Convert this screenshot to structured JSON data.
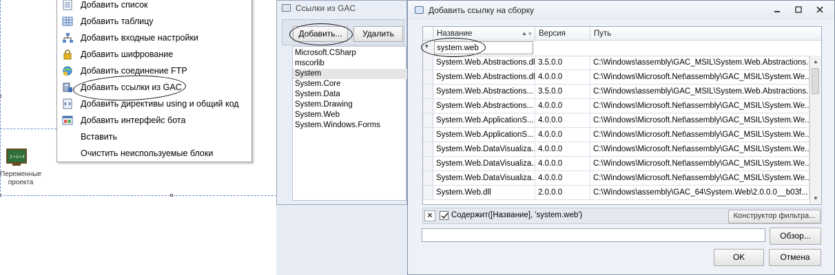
{
  "context_menu": {
    "items": [
      {
        "label": "Добавить список",
        "icon": "list-icon"
      },
      {
        "label": "Добавить таблицу",
        "icon": "table-icon"
      },
      {
        "label": "Добавить входные настройки",
        "icon": "input-settings-icon"
      },
      {
        "label": "Добавить шифрование",
        "icon": "lock-icon"
      },
      {
        "label": "Добавить соединение FTP",
        "icon": "ftp-icon"
      },
      {
        "label": "Добавить ссылки из GAC",
        "icon": "gac-references-icon"
      },
      {
        "label": "Добавить директивы using и общий код",
        "icon": "code-icon"
      },
      {
        "label": "Добавить интерфейс бота",
        "icon": "bot-interface-icon"
      },
      {
        "label": "Вставить",
        "icon": ""
      },
      {
        "label": "Очистить неиспользуемые блоки",
        "icon": ""
      }
    ]
  },
  "canvas": {
    "toolbox_label": "Переменные проекта"
  },
  "gac_window": {
    "title": "Ссылки из GAC",
    "add_button": "Добавить...",
    "remove_button": "Удалить",
    "items": [
      "Microsoft.CSharp",
      "mscorlib",
      "System",
      "System.Core",
      "System.Data",
      "System.Drawing",
      "System.Web",
      "System.Windows.Forms"
    ],
    "selected_index": 2
  },
  "dialog": {
    "title": "Добавить ссылку на сборку",
    "columns": {
      "name": "Название",
      "version": "Версия",
      "path": "Путь"
    },
    "filter_value": "system.web",
    "rows": [
      {
        "name": "System.Web.Abstractions.dll",
        "version": "3.5.0.0",
        "path": "C:\\Windows\\assembly\\GAC_MSIL\\System.Web.Abstractions...."
      },
      {
        "name": "System.Web.Abstractions.dll",
        "version": "4.0.0.0",
        "path": "C:\\Windows\\Microsoft.Net\\assembly\\GAC_MSIL\\System.We..."
      },
      {
        "name": "System.Web.Abstractions...",
        "version": "3.5.0.0",
        "path": "C:\\Windows\\assembly\\GAC_MSIL\\System.Web.Abstractions...."
      },
      {
        "name": "System.Web.Abstractions...",
        "version": "4.0.0.0",
        "path": "C:\\Windows\\Microsoft.Net\\assembly\\GAC_MSIL\\System.We..."
      },
      {
        "name": "System.Web.ApplicationS...",
        "version": "4.0.0.0",
        "path": "C:\\Windows\\Microsoft.Net\\assembly\\GAC_MSIL\\System.We..."
      },
      {
        "name": "System.Web.ApplicationS...",
        "version": "4.0.0.0",
        "path": "C:\\Windows\\Microsoft.Net\\assembly\\GAC_MSIL\\System.We..."
      },
      {
        "name": "System.Web.DataVisualiza...",
        "version": "4.0.0.0",
        "path": "C:\\Windows\\Microsoft.Net\\assembly\\GAC_MSIL\\System.We..."
      },
      {
        "name": "System.Web.DataVisualiza...",
        "version": "4.0.0.0",
        "path": "C:\\Windows\\Microsoft.Net\\assembly\\GAC_MSIL\\System.We..."
      },
      {
        "name": "System.Web.DataVisualiza...",
        "version": "4.0.0.0",
        "path": "C:\\Windows\\Microsoft.Net\\assembly\\GAC_MSIL\\System.We..."
      },
      {
        "name": "System.Web.dll",
        "version": "2.0.0.0",
        "path": "C:\\Windows\\assembly\\GAC_64\\System.Web\\2.0.0.0__b03f..."
      }
    ],
    "filter_expression": "Содержит([Название], 'system.web')",
    "filter_builder_button": "Конструктор фильтра...",
    "path_input_value": "",
    "browse_button": "Обзор...",
    "ok_button": "OK",
    "cancel_button": "Отмена"
  }
}
